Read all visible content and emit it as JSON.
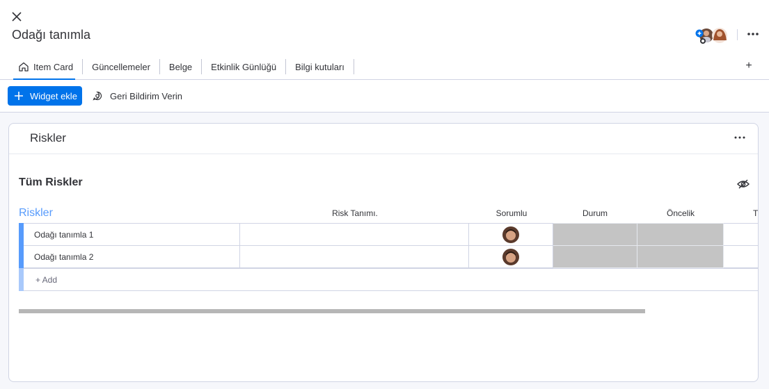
{
  "header": {
    "title": "Odağı tanımla"
  },
  "tabs": [
    {
      "label": "Item Card",
      "icon": "home-icon"
    },
    {
      "label": "Güncellemeler"
    },
    {
      "label": "Belge"
    },
    {
      "label": "Etkinlik Günlüğü"
    },
    {
      "label": "Bilgi kutuları"
    }
  ],
  "toolbar": {
    "add_widget_label": "Widget ekle",
    "feedback_label": "Geri Bildirim Verin"
  },
  "widget": {
    "title": "Riskler",
    "section_title": "Tüm Riskler",
    "group_name": "Riskler",
    "columns": [
      "Risk Tanımı.",
      "Sorumlu",
      "Durum",
      "Öncelik",
      "T"
    ],
    "rows": [
      {
        "name": "Odağı tanımla 1"
      },
      {
        "name": "Odağı tanımla 2"
      }
    ],
    "add_label": "+ Add"
  },
  "colors": {
    "accent": "#0073ea",
    "group": "#579bfc",
    "empty_status": "#c4c4c4"
  }
}
